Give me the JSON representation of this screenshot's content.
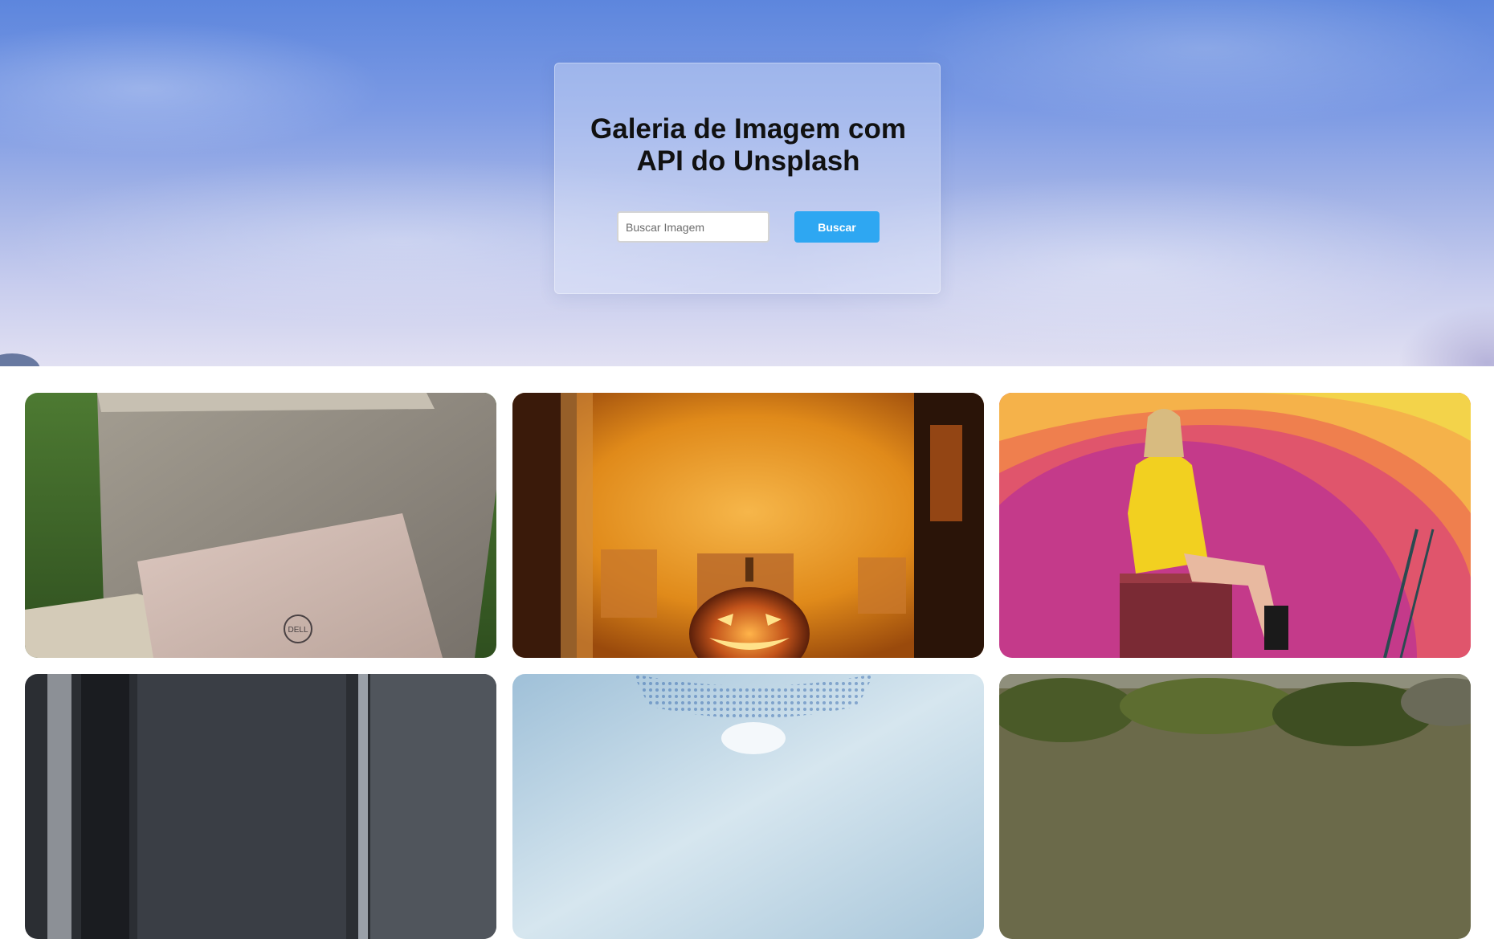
{
  "header": {
    "title": "Galeria de Imagem com API do Unsplash"
  },
  "search": {
    "placeholder": "Buscar Imagem",
    "value": "",
    "button_label": "Buscar"
  },
  "colors": {
    "accent": "#2ea7f2",
    "sky_top": "#5d86dd",
    "sky_bottom": "#e1e0f2"
  },
  "gallery": {
    "images": [
      {
        "subject": "laptop-on-concrete",
        "logo_text": "DELL"
      },
      {
        "subject": "jack-o-lantern-in-window"
      },
      {
        "subject": "woman-on-painted-wall"
      },
      {
        "subject": "dark-interior"
      },
      {
        "subject": "glass-pattern"
      },
      {
        "subject": "trees"
      }
    ]
  }
}
